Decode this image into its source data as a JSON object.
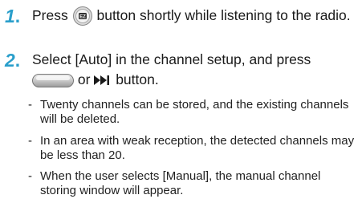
{
  "steps": [
    {
      "number": "1",
      "text_before_icon": "Press",
      "icon": "ez-button-icon",
      "text_after_icon": "button shortly while listening to the radio."
    },
    {
      "number": "2",
      "text_line1": "Select [Auto] in the channel setup, and press",
      "icon_wide": "wide-bar-button-icon",
      "text_or": "or",
      "icon_skip": "skip-forward-icon",
      "text_end": "button."
    }
  ],
  "notes": [
    "Twenty channels can be stored, and the existing channels will be deleted.",
    "In an area with weak reception, the detected channels may be less than 20.",
    "When the user selects [Manual], the manual channel storing window will appear."
  ],
  "note_dash": "-",
  "colors": {
    "step_number": "#2a9fcb",
    "text": "#1a1a1a"
  }
}
